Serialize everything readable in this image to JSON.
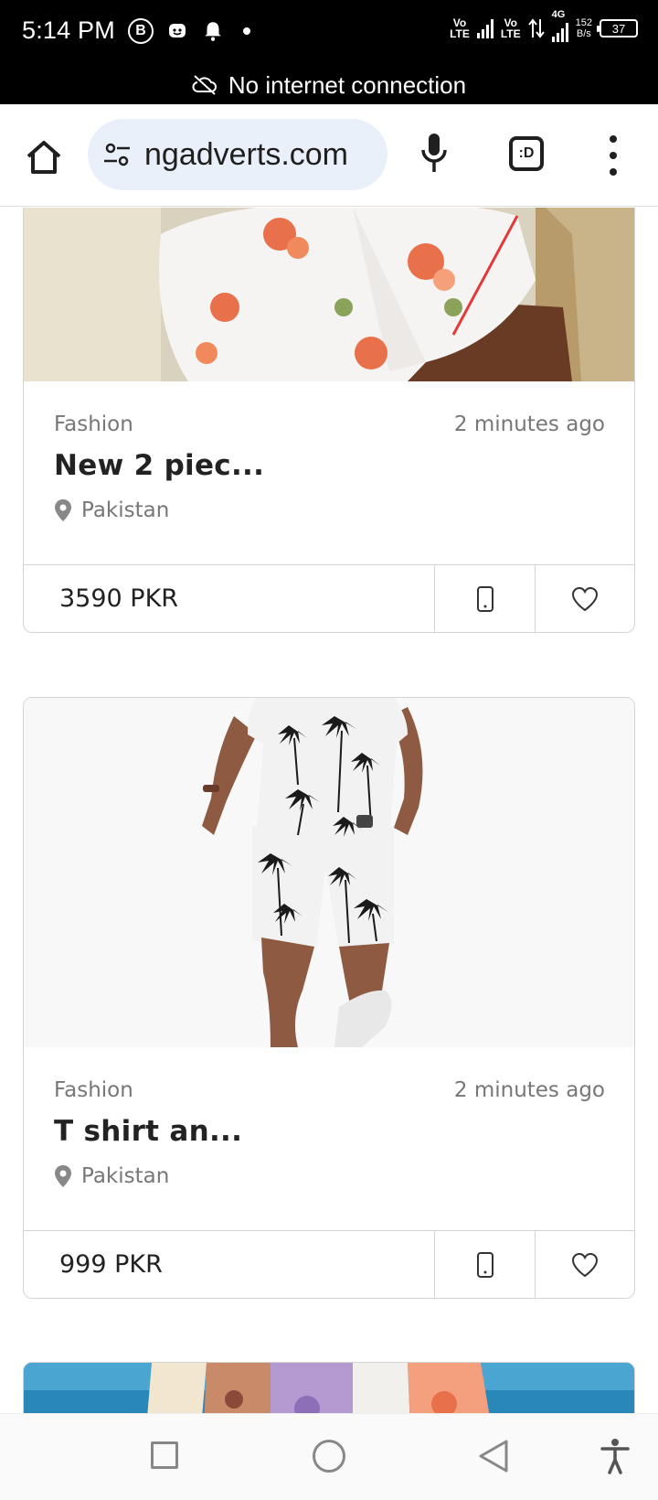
{
  "status_bar": {
    "time": "5:14 PM",
    "b_icon_letter": "B",
    "volte1_top": "Vo",
    "volte1_bottom": "LTE",
    "volte2_top": "Vo",
    "volte2_bottom": "LTE",
    "network_type": "4G",
    "speed_value": "152",
    "speed_unit": "B/s",
    "battery": "37"
  },
  "offline_banner": {
    "text": "No internet connection",
    "icon": "cloud-off-icon"
  },
  "browser": {
    "url": "ngadverts.com",
    "tabs_label": ":D",
    "icons": [
      "home-icon",
      "tune-icon",
      "mic-icon",
      "tabs-icon",
      "more-vert-icon"
    ]
  },
  "listings": [
    {
      "category": "Fashion",
      "time": "2 minutes ago",
      "title": "New 2 piec...",
      "location": "Pakistan",
      "price": "3590 PKR"
    },
    {
      "category": "Fashion",
      "time": "2 minutes ago",
      "title": "T shirt an...",
      "location": "Pakistan",
      "price": "999 PKR"
    }
  ],
  "colors": {
    "status_bg": "#000000",
    "url_bar_bg": "#eaf0fa",
    "muted_text": "#777777",
    "border": "#d4d4d4"
  }
}
